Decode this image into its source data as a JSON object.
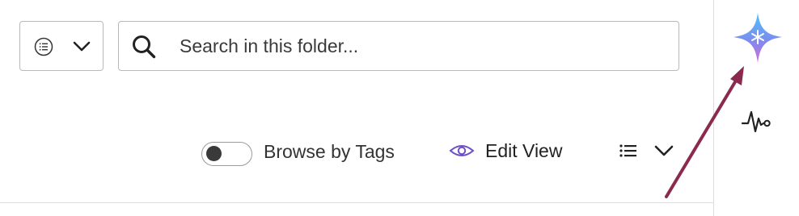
{
  "toolbar": {
    "filter_icon": "list-circle-icon",
    "filter_chevron_icon": "chevron-down-icon",
    "search": {
      "icon": "search-icon",
      "placeholder": "Search in this folder...",
      "value": ""
    }
  },
  "view_controls": {
    "browse_toggle": {
      "label": "Browse by Tags",
      "on": false
    },
    "edit_view": {
      "label": "Edit View",
      "icon": "eye-icon"
    },
    "view_menu_icon": "list-view-icon"
  },
  "right_rail": {
    "ai_icon": "ai-sparkle-icon",
    "activity_icon": "activity-icon"
  },
  "annotation": {
    "arrow_color": "#8b2a4e"
  },
  "colors": {
    "eye": "#6f4fc4",
    "border": "#b9b9b9"
  }
}
